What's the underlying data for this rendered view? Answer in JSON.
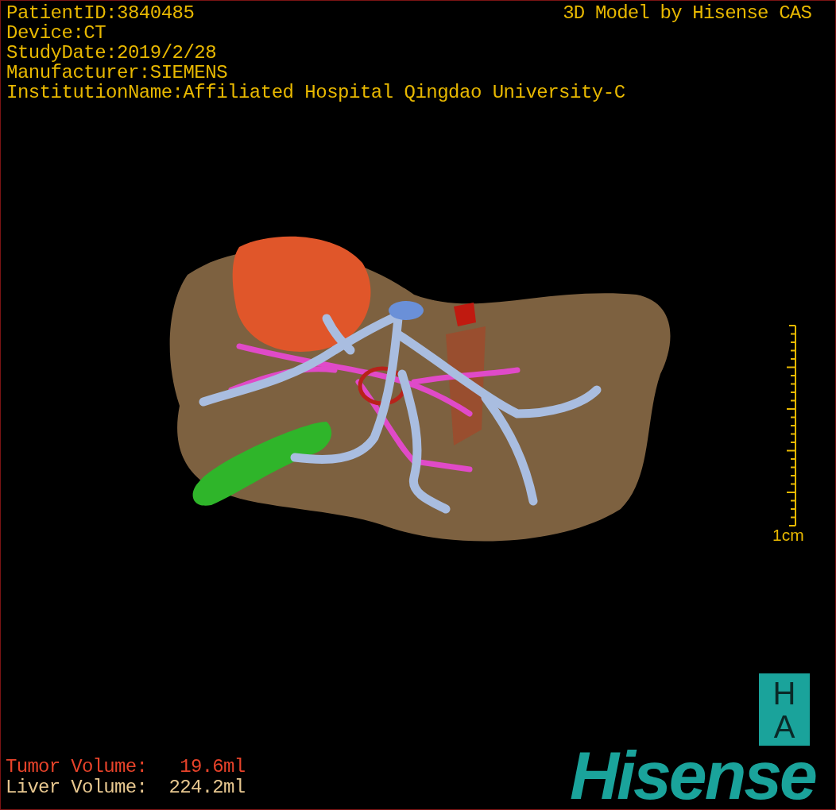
{
  "viewport": {
    "info_lines": [
      "PatientID:3840485",
      "Device:CT",
      "StudyDate:2019/2/28",
      "Manufacturer:SIEMENS",
      "InstitutionName:Affiliated Hospital Qingdao University-C"
    ],
    "model_credit": "3D Model by Hisense CAS",
    "scale_bar": {
      "label": "1cm"
    },
    "volumes": [
      {
        "kind": "tumor",
        "text": "Tumor Volume:   19.6ml"
      },
      {
        "kind": "liver",
        "text": "Liver Volume:  224.2ml"
      }
    ],
    "logo": {
      "badge_letters": [
        "H",
        "A"
      ],
      "wordmark": "Hisense"
    }
  }
}
